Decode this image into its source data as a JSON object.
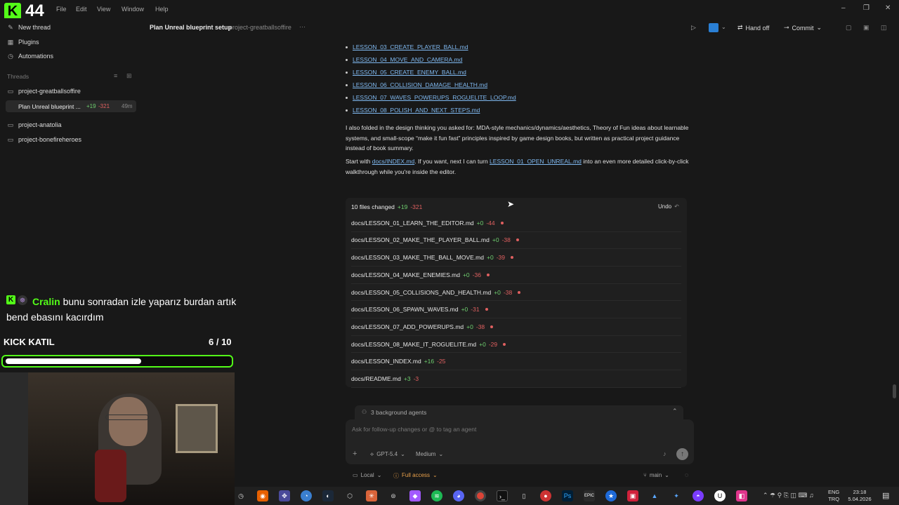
{
  "window": {
    "kick_count": "44",
    "menu": [
      "File",
      "Edit",
      "View",
      "Window",
      "Help"
    ],
    "controls": {
      "minimize": "–",
      "restore": "❐",
      "close": "✕"
    }
  },
  "sidebar": {
    "new_thread": "New thread",
    "plugins": "Plugins",
    "automations": "Automations",
    "threads_label": "Threads",
    "projects": [
      {
        "name": "project-greatballsoffire",
        "threads": [
          {
            "title": "Plan Unreal blueprint ...",
            "added": "+19",
            "removed": "-321",
            "age": "49m"
          }
        ]
      },
      {
        "name": "project-anatolia",
        "threads": []
      },
      {
        "name": "project-bonefireheroes",
        "threads": []
      }
    ]
  },
  "header": {
    "title": "Plan Unreal blueprint setup",
    "project": "project-greatballsoffire",
    "more": "···",
    "hand_off": "Hand off",
    "commit": "Commit"
  },
  "lessons": [
    "LESSON_03_CREATE_PLAYER_BALL.md",
    "LESSON_04_MOVE_AND_CAMERA.md",
    "LESSON_05_CREATE_ENEMY_BALL.md",
    "LESSON_06_COLLISION_DAMAGE_HEALTH.md",
    "LESSON_07_WAVES_POWERUPS_ROGUELITE_LOOP.md",
    "LESSON_08_POLISH_AND_NEXT_STEPS.md"
  ],
  "message": {
    "para1": "I also folded in the design thinking you asked for: MDA-style mechanics/dynamics/aesthetics, Theory of Fun ideas about learnable systems, and small-scope “make it fun fast” principles inspired by game design books, but written as practical project guidance instead of book summary.",
    "para2_pre": "Start with ",
    "para2_link1": "docs/INDEX.md",
    "para2_mid": ". If you want, next I can turn ",
    "para2_link2": "LESSON_01_OPEN_UNREAL.md",
    "para2_post": " into an even more detailed click-by-click walkthrough while you're inside the editor."
  },
  "changes": {
    "summary": "10 files changed",
    "added": "+19",
    "removed": "-321",
    "undo": "Undo",
    "files": [
      {
        "path": "docs/LESSON_01_LEARN_THE_EDITOR.md",
        "added": "+0",
        "removed": "-44",
        "dot": true
      },
      {
        "path": "docs/LESSON_02_MAKE_THE_PLAYER_BALL.md",
        "added": "+0",
        "removed": "-38",
        "dot": true
      },
      {
        "path": "docs/LESSON_03_MAKE_THE_BALL_MOVE.md",
        "added": "+0",
        "removed": "-39",
        "dot": true
      },
      {
        "path": "docs/LESSON_04_MAKE_ENEMIES.md",
        "added": "+0",
        "removed": "-36",
        "dot": true
      },
      {
        "path": "docs/LESSON_05_COLLISIONS_AND_HEALTH.md",
        "added": "+0",
        "removed": "-38",
        "dot": true
      },
      {
        "path": "docs/LESSON_06_SPAWN_WAVES.md",
        "added": "+0",
        "removed": "-31",
        "dot": true
      },
      {
        "path": "docs/LESSON_07_ADD_POWERUPS.md",
        "added": "+0",
        "removed": "-38",
        "dot": true
      },
      {
        "path": "docs/LESSON_08_MAKE_IT_ROGUELITE.md",
        "added": "+0",
        "removed": "-29",
        "dot": true
      },
      {
        "path": "docs/LESSON_INDEX.md",
        "added": "+16",
        "removed": "-25",
        "dot": false
      },
      {
        "path": "docs/README.md",
        "added": "+3",
        "removed": "-3",
        "dot": false
      }
    ]
  },
  "composer": {
    "agents": "3 background agents",
    "placeholder": "Ask for follow-up changes or @ to tag an agent",
    "model": "GPT-5.4",
    "effort": "Medium",
    "env": "Local",
    "access": "Full access",
    "branch": "main"
  },
  "overlay": {
    "chat_user": "Cralin",
    "chat_msg": "bunu sonradan izle yaparız burdan artık bend ebasını kacırdım",
    "goal_label": "KICK KATIL",
    "goal_value": "6 / 10",
    "goal_progress": 0.6
  },
  "taskbar": {
    "lang": "ENG",
    "layout": "TRQ",
    "time": "23:18",
    "date": "5.04.2026"
  },
  "colors": {
    "kick_green": "#53fc18",
    "added": "#6fcf6f",
    "removed": "#e06060",
    "link": "#7fb8ef"
  }
}
